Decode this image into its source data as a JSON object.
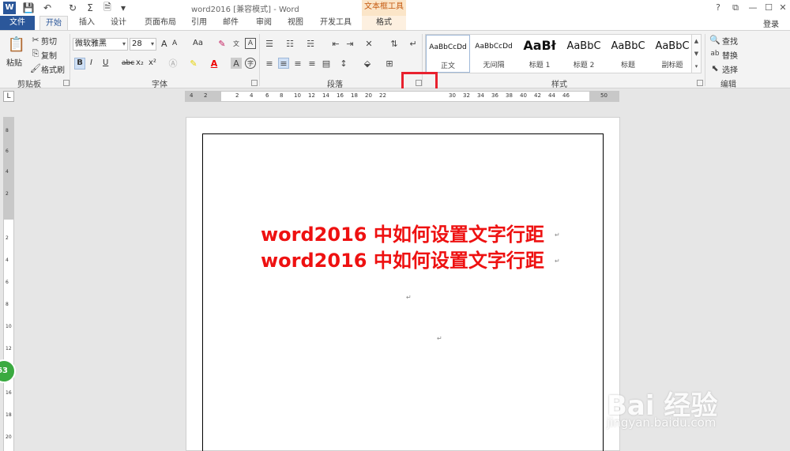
{
  "app": {
    "title": "word2016 [兼容模式] - Word",
    "context_tab_group": "文本框工具",
    "login": "登录",
    "logo_letter": "W",
    "window_controls": [
      "?",
      "⧉",
      "—",
      "☐",
      "✕"
    ]
  },
  "tabs": [
    "文件",
    "开始",
    "插入",
    "设计",
    "页面布局",
    "引用",
    "邮件",
    "审阅",
    "视图",
    "开发工具",
    "格式"
  ],
  "clipboard": {
    "paste": "粘贴",
    "cut": "剪切",
    "copy": "复制",
    "format_painter": "格式刷",
    "label": "剪贴板"
  },
  "font": {
    "name": "微软雅黑",
    "size": "28",
    "label": "字体",
    "bold": "B",
    "italic": "I",
    "underline": "U",
    "strike": "abc",
    "subscript": "x₂",
    "superscript": "x²",
    "grow": "A",
    "shrink": "A",
    "case": "Aa"
  },
  "paragraph": {
    "label": "段落"
  },
  "styles": {
    "label": "样式",
    "items": [
      {
        "sample": "AaBbCcDd",
        "name": "正文"
      },
      {
        "sample": "AaBbCcDd",
        "name": "无间隔"
      },
      {
        "sample": "AaBł",
        "name": "标题 1"
      },
      {
        "sample": "AaBbC",
        "name": "标题 2"
      },
      {
        "sample": "AaBbC",
        "name": "标题"
      },
      {
        "sample": "AaBbC",
        "name": "副标题"
      }
    ]
  },
  "editing": {
    "find": "查找",
    "replace": "替换",
    "select": "选择",
    "label": "编辑"
  },
  "ruler": {
    "corner": "L",
    "ticks": [
      "4",
      "2",
      "2",
      "4",
      "6",
      "8",
      "10",
      "12",
      "14",
      "16",
      "18",
      "20",
      "22",
      "30",
      "32",
      "34",
      "36",
      "38",
      "40",
      "42",
      "44",
      "46",
      "50"
    ],
    "vticks": [
      "8",
      "6",
      "4",
      "2",
      "2",
      "4",
      "6",
      "8",
      "10",
      "12",
      "14",
      "16",
      "18",
      "20"
    ]
  },
  "document": {
    "lines": [
      "word2016 中如何设置文字行距",
      "word2016 中如何设置文字行距"
    ],
    "para_mark": "↵"
  },
  "badge": "63",
  "watermark": {
    "main": "Bai 经验",
    "sub": "jingyan.baidu.com"
  },
  "colors": {
    "accent": "#2b579a",
    "doc_text": "#ee1111",
    "highlight": "#e8212e",
    "context_tab": "#fbe5c8"
  }
}
